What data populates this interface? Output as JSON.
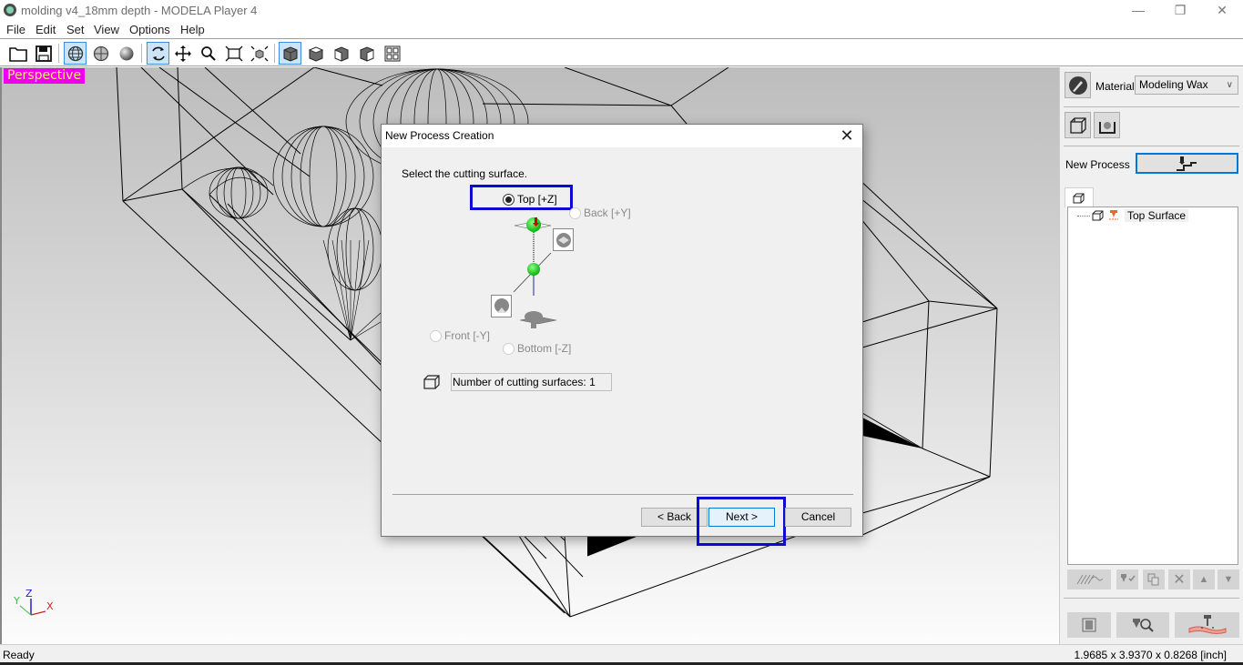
{
  "window": {
    "title": "molding v4_18mm depth  - MODELA Player 4",
    "minimize_glyph": "—",
    "restore_glyph": "❐",
    "close_glyph": "✕"
  },
  "menu": [
    "File",
    "Edit",
    "Set",
    "View",
    "Options",
    "Help"
  ],
  "toolbar": {
    "buttons": [
      {
        "name": "open-icon",
        "active": false
      },
      {
        "name": "save-icon",
        "active": false
      },
      {
        "name": "wireframe-view-icon",
        "active": true
      },
      {
        "name": "surface-view-icon",
        "active": false
      },
      {
        "name": "render-view-icon",
        "active": false
      },
      {
        "name": "rotate-icon",
        "active": true
      },
      {
        "name": "pan-icon",
        "active": false
      },
      {
        "name": "zoom-icon",
        "active": false
      },
      {
        "name": "fit-view-icon",
        "active": false
      },
      {
        "name": "fit-model-icon",
        "active": false
      },
      {
        "name": "view-perspective-cube-icon",
        "active": true
      },
      {
        "name": "view-top-cube-icon",
        "active": false
      },
      {
        "name": "view-front-cube-icon",
        "active": false
      },
      {
        "name": "view-side-cube-icon",
        "active": false
      },
      {
        "name": "four-view-icon",
        "active": false
      }
    ]
  },
  "viewport": {
    "view_label": "Perspective",
    "axis_labels": {
      "x": "X",
      "y": "Y",
      "z": "Z"
    },
    "colors": {
      "label_bg": "#ee00ee",
      "label_text": "#ffe37a",
      "axis_x": "#cc2222",
      "axis_y": "#44bb44",
      "axis_z": "#2222cc"
    }
  },
  "right_panel": {
    "material_label": "Material",
    "material_value": "Modeling Wax",
    "new_process_label": "New Process",
    "tree_items": [
      {
        "label": "Top Surface"
      }
    ]
  },
  "dialog": {
    "title": "New Process Creation",
    "close_glyph": "✕",
    "instruction": "Select the cutting surface.",
    "options": [
      {
        "label": "Top [+Z]",
        "selected": true,
        "enabled": true
      },
      {
        "label": "Back [+Y]",
        "selected": false,
        "enabled": false
      },
      {
        "label": "Front [-Y]",
        "selected": false,
        "enabled": false
      },
      {
        "label": "Bottom [-Z]",
        "selected": false,
        "enabled": false
      }
    ],
    "count_text": "Number of cutting surfaces: 1",
    "buttons": {
      "back": "< Back",
      "next": "Next >",
      "cancel": "Cancel"
    },
    "highlight_color": "#0a0ad0"
  },
  "status": {
    "text": "Ready",
    "dimensions": "1.9685 x 3.9370 x 0.8268 [inch]"
  }
}
